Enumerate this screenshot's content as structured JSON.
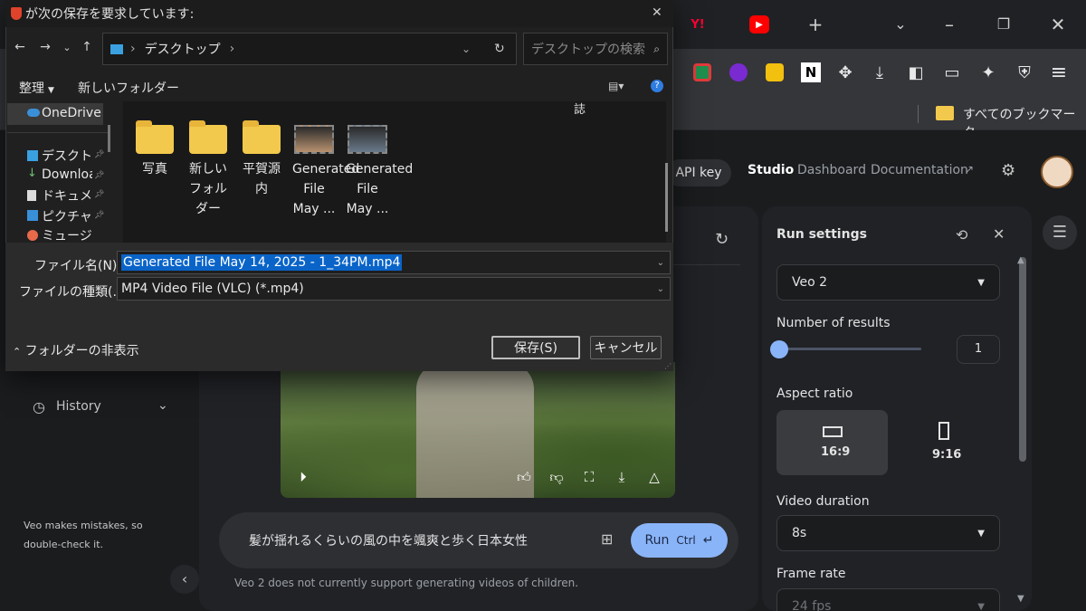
{
  "browser": {
    "tabs": [
      {
        "icon": "yahoo-icon",
        "label": "Y!",
        "color": "#ff0033"
      },
      {
        "icon": "youtube-icon",
        "label": "▶",
        "color": "#ff0000"
      }
    ],
    "new_tab_symbol": "+",
    "bookmarks_label": "すべてのブックマーク"
  },
  "header": {
    "api_key": "API key",
    "links": [
      "Studio",
      "Dashboard",
      "Documentation"
    ]
  },
  "left_nav": {
    "history": "History",
    "disclaimer": "Veo makes mistakes, so double-check it."
  },
  "prompt": {
    "text": "髪が揺れるくらいの風の中を颯爽と歩く日本女性",
    "run_label": "Run",
    "shortcut": "Ctrl",
    "note": "Veo 2 does not currently support generating videos of children."
  },
  "run_settings": {
    "title": "Run settings",
    "model": "Veo 2",
    "number_of_results_label": "Number of results",
    "number_of_results": "1",
    "number_of_results_slider_value": 1,
    "aspect_ratio_label": "Aspect ratio",
    "aspect_options": [
      {
        "label": "16:9",
        "selected": true
      },
      {
        "label": "9:16",
        "selected": false
      }
    ],
    "video_duration_label": "Video duration",
    "video_duration": "8s",
    "frame_rate_label": "Frame rate",
    "frame_rate": "24 fps"
  },
  "save_dialog": {
    "title": "が次の保存を要求しています:",
    "path": "デスクトップ",
    "search_placeholder": "デスクトップの検索",
    "organize": "整理",
    "new_folder": "新しいフォルダー",
    "nav_items": [
      {
        "label": "OneDrive",
        "icon": "cloud-icon"
      },
      {
        "label": "デスクトップ",
        "icon": "desktop-icon"
      },
      {
        "label": "Downloads",
        "icon": "download-icon"
      },
      {
        "label": "ドキュメント",
        "icon": "document-icon"
      },
      {
        "label": "ピクチャ",
        "icon": "picture-icon"
      },
      {
        "label": "ミュージック",
        "icon": "music-icon"
      }
    ],
    "files": [
      {
        "label": "写真",
        "type": "folder"
      },
      {
        "label": "新しいフォルダー",
        "type": "folder"
      },
      {
        "label": "平賀源内",
        "type": "folder"
      },
      {
        "label": "Generated File May ...",
        "type": "video"
      },
      {
        "label": "Generated File May ...",
        "type": "video"
      }
    ],
    "scroll_hint": "誌",
    "filename_label": "ファイル名(N):",
    "filename": "Generated File May 14, 2025 - 1_34PM.mp4",
    "filetype_label": "ファイルの種類(...",
    "filetype": "MP4 Video File (VLC) (*.mp4)",
    "hide_folders": "フォルダーの非表示",
    "save_button": "保存(S)",
    "cancel_button": "キャンセル"
  }
}
